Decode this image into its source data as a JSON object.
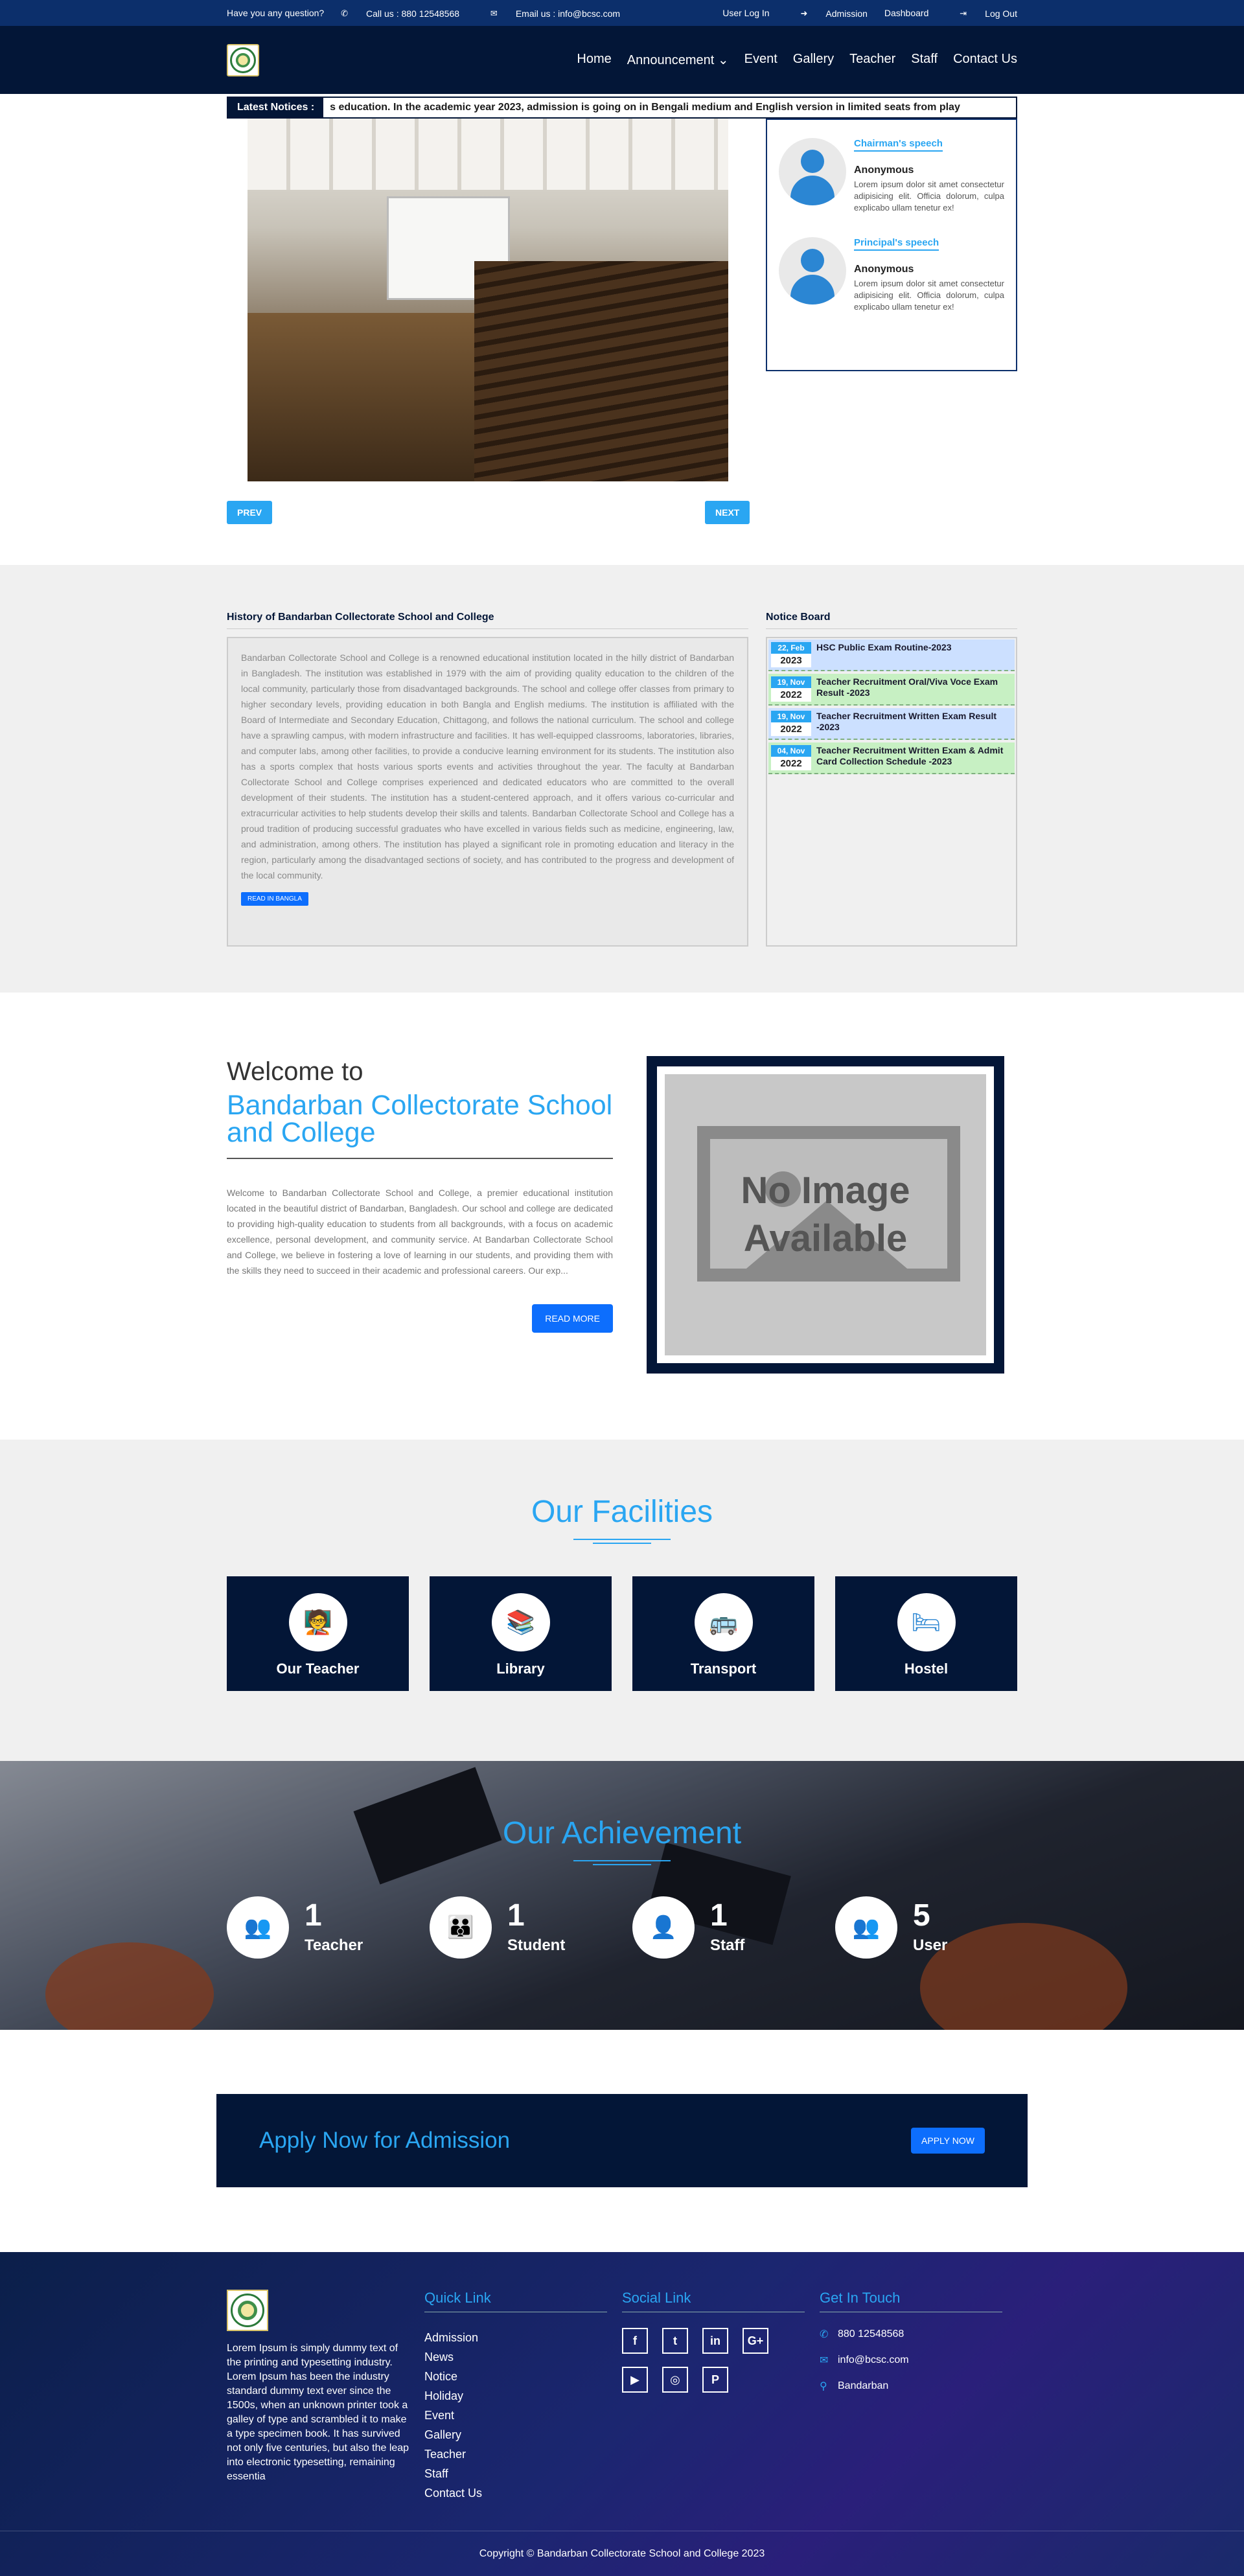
{
  "topbar": {
    "question": "Have you any question?",
    "call": "Call us : 880 12548568",
    "email": "Email us : info@bcsc.com",
    "user_login": "User Log In",
    "admission": "Admission",
    "dashboard": "Dashboard",
    "logout": "Log Out"
  },
  "nav": {
    "home": "Home",
    "announcement": "Announcement",
    "event": "Event",
    "gallery": "Gallery",
    "teacher": "Teacher",
    "staff": "Staff",
    "contact": "Contact Us"
  },
  "ticker": {
    "label": "Latest Notices :",
    "text": "s education.     In the academic year 2023, admission is going on in Bengali medium and English version in limited seats from play"
  },
  "slider": {
    "prev": "PREV",
    "next": "NEXT"
  },
  "speeches": [
    {
      "title": "Chairman's speech",
      "name": "Anonymous",
      "text": "Lorem ipsum dolor sit amet consectetur adipisicing elit. Officia dolorum, culpa explicabo ullam tenetur ex!"
    },
    {
      "title": "Principal's speech",
      "name": "Anonymous",
      "text": "Lorem ipsum dolor sit amet consectetur adipisicing elit. Officia dolorum, culpa explicabo ullam tenetur ex!"
    }
  ],
  "history": {
    "title": "History of Bandarban Collectorate School and College",
    "text": "Bandarban Collectorate School and College is a renowned educational institution located in the hilly district of Bandarban in Bangladesh. The institution was established in 1979 with the aim of providing quality education to the children of the local community, particularly those from disadvantaged backgrounds. The school and college offer classes from primary to higher secondary levels, providing education in both Bangla and English mediums. The institution is affiliated with the Board of Intermediate and Secondary Education, Chittagong, and follows the national curriculum. The school and college have a sprawling campus, with modern infrastructure and facilities. It has well-equipped classrooms, laboratories, libraries, and computer labs, among other facilities, to provide a conducive learning environment for its students. The institution also has a sports complex that hosts various sports events and activities throughout the year. The faculty at Bandarban Collectorate School and College comprises experienced and dedicated educators who are committed to the overall development of their students. The institution has a student-centered approach, and it offers various co-curricular and extracurricular activities to help students develop their skills and talents. Bandarban Collectorate School and College has a proud tradition of producing successful graduates who have excelled in various fields such as medicine, engineering, law, and administration, among others. The institution has played a significant role in promoting education and literacy in the region, particularly among the disadvantaged sections of society, and has contributed to the progress and development of the local community.",
    "read_btn": "READ IN BANGLA"
  },
  "notice_board": {
    "title": "Notice Board",
    "items": [
      {
        "dm": "22, Feb",
        "yr": "2023",
        "text": "HSC Public Exam Routine-2023"
      },
      {
        "dm": "19, Nov",
        "yr": "2022",
        "text": "Teacher Recruitment Oral/Viva Voce Exam Result -2023"
      },
      {
        "dm": "19, Nov",
        "yr": "2022",
        "text": "Teacher Recruitment Written Exam Result -2023"
      },
      {
        "dm": "04, Nov",
        "yr": "2022",
        "text": "Teacher Recruitment Written Exam & Admit Card Collection Schedule -2023"
      }
    ]
  },
  "welcome": {
    "line1": "Welcome to",
    "line2": "Bandarban Collectorate School and College",
    "text": "Welcome to Bandarban Collectorate School and College, a premier educational institution located in the beautiful district of Bandarban, Bangladesh. Our school and college are dedicated to providing high-quality education to students from all backgrounds, with a focus on academic excellence, personal development, and community service. At Bandarban Collectorate School and College, we believe in fostering a love of learning in our students, and providing them with the skills they need to succeed in their academic and professional careers. Our exp...",
    "read_more": "READ MORE",
    "no_image": "No Image Available"
  },
  "facilities": {
    "title": "Our Facilities",
    "items": [
      {
        "label": "Our Teacher",
        "icon": "teacher-icon"
      },
      {
        "label": "Library",
        "icon": "books-icon"
      },
      {
        "label": "Transport",
        "icon": "bus-icon"
      },
      {
        "label": "Hostel",
        "icon": "bed-icon"
      }
    ]
  },
  "achievement": {
    "title": "Our Achievement",
    "items": [
      {
        "num": "1",
        "label": "Teacher",
        "icon": "teacher-group-icon"
      },
      {
        "num": "1",
        "label": "Student",
        "icon": "students-icon"
      },
      {
        "num": "1",
        "label": "Staff",
        "icon": "staff-icon"
      },
      {
        "num": "5",
        "label": "User",
        "icon": "users-icon"
      }
    ]
  },
  "apply": {
    "title": "Apply Now for Admission",
    "btn": "APPLY NOW"
  },
  "footer": {
    "about": "Lorem Ipsum is simply dummy text of the printing and typesetting industry. Lorem Ipsum has been the industry standard dummy text ever since the 1500s, when an unknown printer took a galley of type and scrambled it to make a type specimen book. It has survived not only five centuries, but also the leap into electronic typesetting, remaining essentia",
    "quick_title": "Quick Link",
    "quick_links": [
      "Admission",
      "News",
      "Notice",
      "Holiday",
      "Event",
      "Gallery",
      "Teacher",
      "Staff",
      "Contact Us"
    ],
    "social_title": "Social Link",
    "contact_title": "Get In Touch",
    "phone": "880 12548568",
    "email": "info@bcsc.com",
    "location": "Bandarban",
    "copyright": "Copyright © Bandarban Collectorate School and College 2023"
  }
}
